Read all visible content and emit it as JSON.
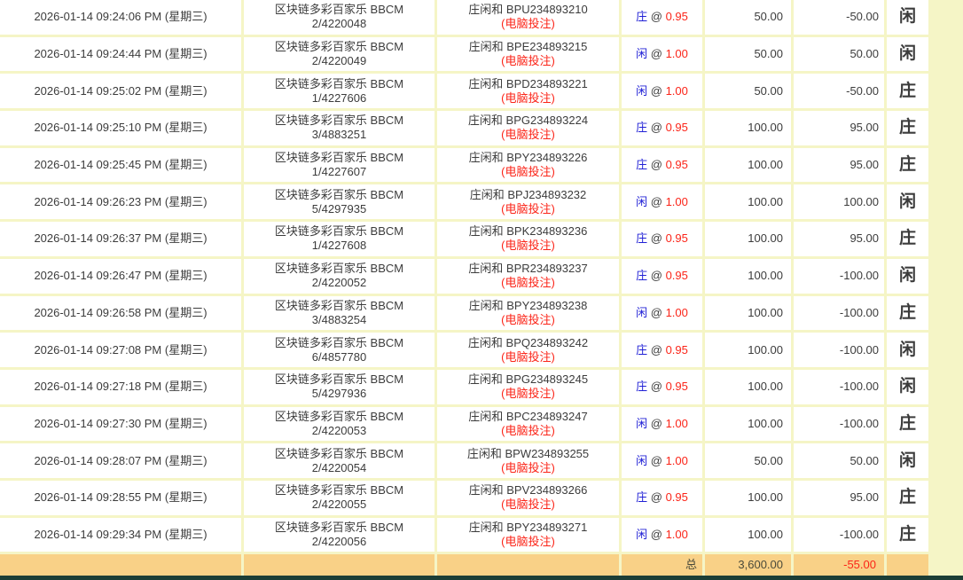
{
  "colors": {
    "page_background": "#F5F5C6",
    "cell_background": "#FFFFFF",
    "totals_background": "#F9D187",
    "bottom_bar": "#1C3E36",
    "negative_red": "#FB2418",
    "positive_blue": "#2626DC",
    "pick_blue": "#2222D6",
    "result_banker_red": "#E31414",
    "result_player_blue": "#2424E4",
    "text_dark": "#3C3C3C"
  },
  "table": {
    "at_sign": "@",
    "rows": [
      {
        "time": "2026-01-14 09:24:06 PM (星期三)",
        "game_line1": "区块链多彩百家乐 BBCM",
        "game_line2": "2/4220048",
        "bet_line1": "庄闲和 BPU234893210",
        "bet_line2": "(电脑投注)",
        "pick": "庄",
        "odds": "0.95",
        "amount": "50.00",
        "winloss": "-50.00",
        "result": "闲"
      },
      {
        "time": "2026-01-14 09:24:44 PM (星期三)",
        "game_line1": "区块链多彩百家乐 BBCM",
        "game_line2": "2/4220049",
        "bet_line1": "庄闲和 BPE234893215",
        "bet_line2": "(电脑投注)",
        "pick": "闲",
        "odds": "1.00",
        "amount": "50.00",
        "winloss": "50.00",
        "result": "闲"
      },
      {
        "time": "2026-01-14 09:25:02 PM (星期三)",
        "game_line1": "区块链多彩百家乐 BBCM",
        "game_line2": "1/4227606",
        "bet_line1": "庄闲和 BPD234893221",
        "bet_line2": "(电脑投注)",
        "pick": "闲",
        "odds": "1.00",
        "amount": "50.00",
        "winloss": "-50.00",
        "result": "庄"
      },
      {
        "time": "2026-01-14 09:25:10 PM (星期三)",
        "game_line1": "区块链多彩百家乐 BBCM",
        "game_line2": "3/4883251",
        "bet_line1": "庄闲和 BPG234893224",
        "bet_line2": "(电脑投注)",
        "pick": "庄",
        "odds": "0.95",
        "amount": "100.00",
        "winloss": "95.00",
        "result": "庄"
      },
      {
        "time": "2026-01-14 09:25:45 PM (星期三)",
        "game_line1": "区块链多彩百家乐 BBCM",
        "game_line2": "1/4227607",
        "bet_line1": "庄闲和 BPY234893226",
        "bet_line2": "(电脑投注)",
        "pick": "庄",
        "odds": "0.95",
        "amount": "100.00",
        "winloss": "95.00",
        "result": "庄"
      },
      {
        "time": "2026-01-14 09:26:23 PM (星期三)",
        "game_line1": "区块链多彩百家乐 BBCM",
        "game_line2": "5/4297935",
        "bet_line1": "庄闲和 BPJ234893232",
        "bet_line2": "(电脑投注)",
        "pick": "闲",
        "odds": "1.00",
        "amount": "100.00",
        "winloss": "100.00",
        "result": "闲"
      },
      {
        "time": "2026-01-14 09:26:37 PM (星期三)",
        "game_line1": "区块链多彩百家乐 BBCM",
        "game_line2": "1/4227608",
        "bet_line1": "庄闲和 BPK234893236",
        "bet_line2": "(电脑投注)",
        "pick": "庄",
        "odds": "0.95",
        "amount": "100.00",
        "winloss": "95.00",
        "result": "庄"
      },
      {
        "time": "2026-01-14 09:26:47 PM (星期三)",
        "game_line1": "区块链多彩百家乐 BBCM",
        "game_line2": "2/4220052",
        "bet_line1": "庄闲和 BPR234893237",
        "bet_line2": "(电脑投注)",
        "pick": "庄",
        "odds": "0.95",
        "amount": "100.00",
        "winloss": "-100.00",
        "result": "闲"
      },
      {
        "time": "2026-01-14 09:26:58 PM (星期三)",
        "game_line1": "区块链多彩百家乐 BBCM",
        "game_line2": "3/4883254",
        "bet_line1": "庄闲和 BPY234893238",
        "bet_line2": "(电脑投注)",
        "pick": "闲",
        "odds": "1.00",
        "amount": "100.00",
        "winloss": "-100.00",
        "result": "庄"
      },
      {
        "time": "2026-01-14 09:27:08 PM (星期三)",
        "game_line1": "区块链多彩百家乐 BBCM",
        "game_line2": "6/4857780",
        "bet_line1": "庄闲和 BPQ234893242",
        "bet_line2": "(电脑投注)",
        "pick": "庄",
        "odds": "0.95",
        "amount": "100.00",
        "winloss": "-100.00",
        "result": "闲"
      },
      {
        "time": "2026-01-14 09:27:18 PM (星期三)",
        "game_line1": "区块链多彩百家乐 BBCM",
        "game_line2": "5/4297936",
        "bet_line1": "庄闲和 BPG234893245",
        "bet_line2": "(电脑投注)",
        "pick": "庄",
        "odds": "0.95",
        "amount": "100.00",
        "winloss": "-100.00",
        "result": "闲"
      },
      {
        "time": "2026-01-14 09:27:30 PM (星期三)",
        "game_line1": "区块链多彩百家乐 BBCM",
        "game_line2": "2/4220053",
        "bet_line1": "庄闲和 BPC234893247",
        "bet_line2": "(电脑投注)",
        "pick": "闲",
        "odds": "1.00",
        "amount": "100.00",
        "winloss": "-100.00",
        "result": "庄"
      },
      {
        "time": "2026-01-14 09:28:07 PM (星期三)",
        "game_line1": "区块链多彩百家乐 BBCM",
        "game_line2": "2/4220054",
        "bet_line1": "庄闲和 BPW234893255",
        "bet_line2": "(电脑投注)",
        "pick": "闲",
        "odds": "1.00",
        "amount": "50.00",
        "winloss": "50.00",
        "result": "闲"
      },
      {
        "time": "2026-01-14 09:28:55 PM (星期三)",
        "game_line1": "区块链多彩百家乐 BBCM",
        "game_line2": "2/4220055",
        "bet_line1": "庄闲和 BPV234893266",
        "bet_line2": "(电脑投注)",
        "pick": "庄",
        "odds": "0.95",
        "amount": "100.00",
        "winloss": "95.00",
        "result": "庄"
      },
      {
        "time": "2026-01-14 09:29:34 PM (星期三)",
        "game_line1": "区块链多彩百家乐 BBCM",
        "game_line2": "2/4220056",
        "bet_line1": "庄闲和 BPY234893271",
        "bet_line2": "(电脑投注)",
        "pick": "闲",
        "odds": "1.00",
        "amount": "100.00",
        "winloss": "-100.00",
        "result": "庄"
      }
    ],
    "totals": {
      "label": "总",
      "amount": "3,600.00",
      "winloss": "-55.00"
    }
  }
}
